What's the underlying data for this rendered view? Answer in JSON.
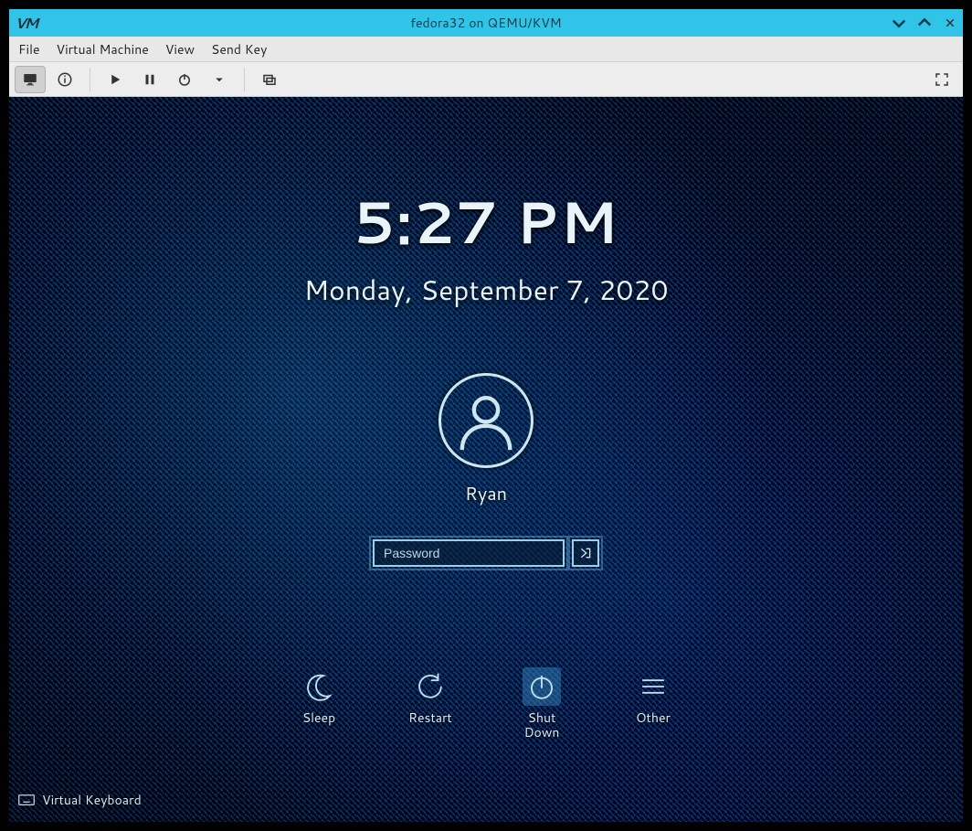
{
  "window": {
    "title": "fedora32 on QEMU/KVM"
  },
  "menubar": {
    "file": "File",
    "virtual_machine": "Virtual Machine",
    "view": "View",
    "send_key": "Send Key"
  },
  "lockscreen": {
    "time": "5:27 PM",
    "date": "Monday, September 7, 2020",
    "username": "Ryan",
    "password_placeholder": "Password",
    "power": {
      "sleep": "Sleep",
      "restart": "Restart",
      "shutdown": "Shut\nDown",
      "other": "Other"
    },
    "virtual_keyboard": "Virtual Keyboard"
  }
}
